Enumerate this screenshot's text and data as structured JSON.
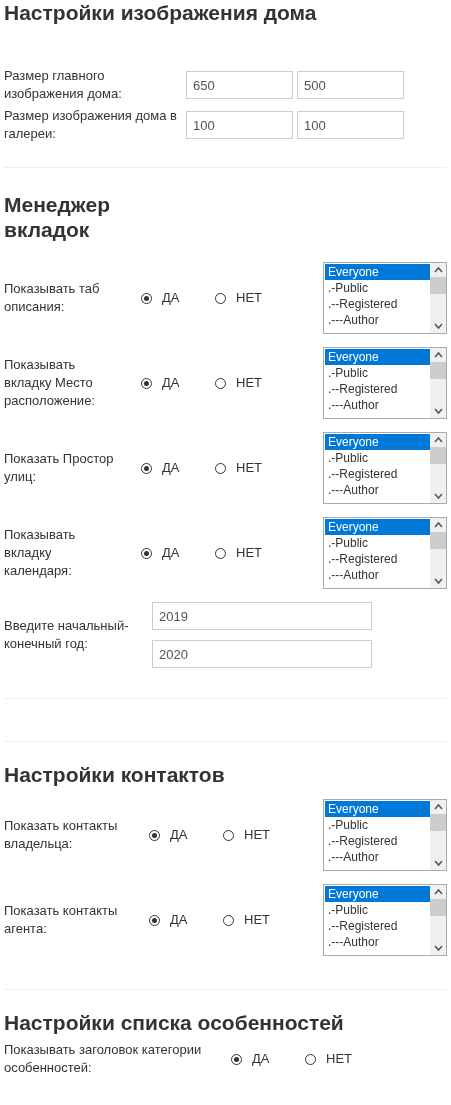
{
  "sections": [
    {
      "title": "Настройки изображения дома",
      "rows": [
        {
          "kind": "size",
          "label": "Размер главного изображения дома:",
          "values": [
            "650",
            "500"
          ]
        },
        {
          "kind": "size",
          "label": "Размер изображения дома в галереи:",
          "values": [
            "100",
            "100"
          ]
        }
      ]
    },
    {
      "title": "Менеджер вкладок",
      "rows": [
        {
          "kind": "toggle",
          "label": "Показывать таб описания:",
          "options": [
            {
              "label": "ДА",
              "selected": true
            },
            {
              "label": "НЕТ",
              "selected": false
            }
          ],
          "access": [
            {
              "label": "Everyone",
              "selected": true
            },
            {
              "label": ".-Public",
              "selected": false
            },
            {
              "label": ".--Registered",
              "selected": false
            },
            {
              "label": ".---Author",
              "selected": false
            }
          ]
        },
        {
          "kind": "toggle",
          "label": "Показывать вкладку Место расположение:",
          "options": [
            {
              "label": "ДА",
              "selected": true
            },
            {
              "label": "НЕТ",
              "selected": false
            }
          ],
          "access": [
            {
              "label": "Everyone",
              "selected": true
            },
            {
              "label": ".-Public",
              "selected": false
            },
            {
              "label": ".--Registered",
              "selected": false
            },
            {
              "label": ".---Author",
              "selected": false
            }
          ]
        },
        {
          "kind": "toggle",
          "label": "Показать Простор улиц:",
          "options": [
            {
              "label": "ДА",
              "selected": true
            },
            {
              "label": "НЕТ",
              "selected": false
            }
          ],
          "access": [
            {
              "label": "Everyone",
              "selected": true
            },
            {
              "label": ".-Public",
              "selected": false
            },
            {
              "label": ".--Registered",
              "selected": false
            },
            {
              "label": ".---Author",
              "selected": false
            }
          ]
        },
        {
          "kind": "toggle",
          "label": "Показывать вкладку календаря:",
          "options": [
            {
              "label": "ДА",
              "selected": true
            },
            {
              "label": "НЕТ",
              "selected": false
            }
          ],
          "access": [
            {
              "label": "Everyone",
              "selected": true
            },
            {
              "label": ".-Public",
              "selected": false
            },
            {
              "label": ".--Registered",
              "selected": false
            },
            {
              "label": ".---Author",
              "selected": false
            }
          ]
        },
        {
          "kind": "years",
          "label": "Введите начальный-конечный год:",
          "values": [
            "2019",
            "2020"
          ]
        }
      ]
    },
    {
      "title": "Настройки контактов",
      "rows": [
        {
          "kind": "toggle",
          "label": "Показать контакты владельца:",
          "options": [
            {
              "label": "ДА",
              "selected": true
            },
            {
              "label": "НЕТ",
              "selected": false
            }
          ],
          "access": [
            {
              "label": "Everyone",
              "selected": true
            },
            {
              "label": ".-Public",
              "selected": false
            },
            {
              "label": ".--Registered",
              "selected": false
            },
            {
              "label": ".---Author",
              "selected": false
            }
          ]
        },
        {
          "kind": "toggle",
          "label": "Показать контакты агента:",
          "options": [
            {
              "label": "ДА",
              "selected": true
            },
            {
              "label": "НЕТ",
              "selected": false
            }
          ],
          "access": [
            {
              "label": "Everyone",
              "selected": true
            },
            {
              "label": ".-Public",
              "selected": false
            },
            {
              "label": ".--Registered",
              "selected": false
            },
            {
              "label": ".---Author",
              "selected": false
            }
          ]
        }
      ]
    },
    {
      "title": "Настройки списка особенностей",
      "rows": [
        {
          "kind": "toggle",
          "label": "Показывать заголовок категории особенностей:",
          "options": [
            {
              "label": "ДА",
              "selected": true
            },
            {
              "label": "НЕТ",
              "selected": false
            }
          ]
        }
      ]
    }
  ]
}
